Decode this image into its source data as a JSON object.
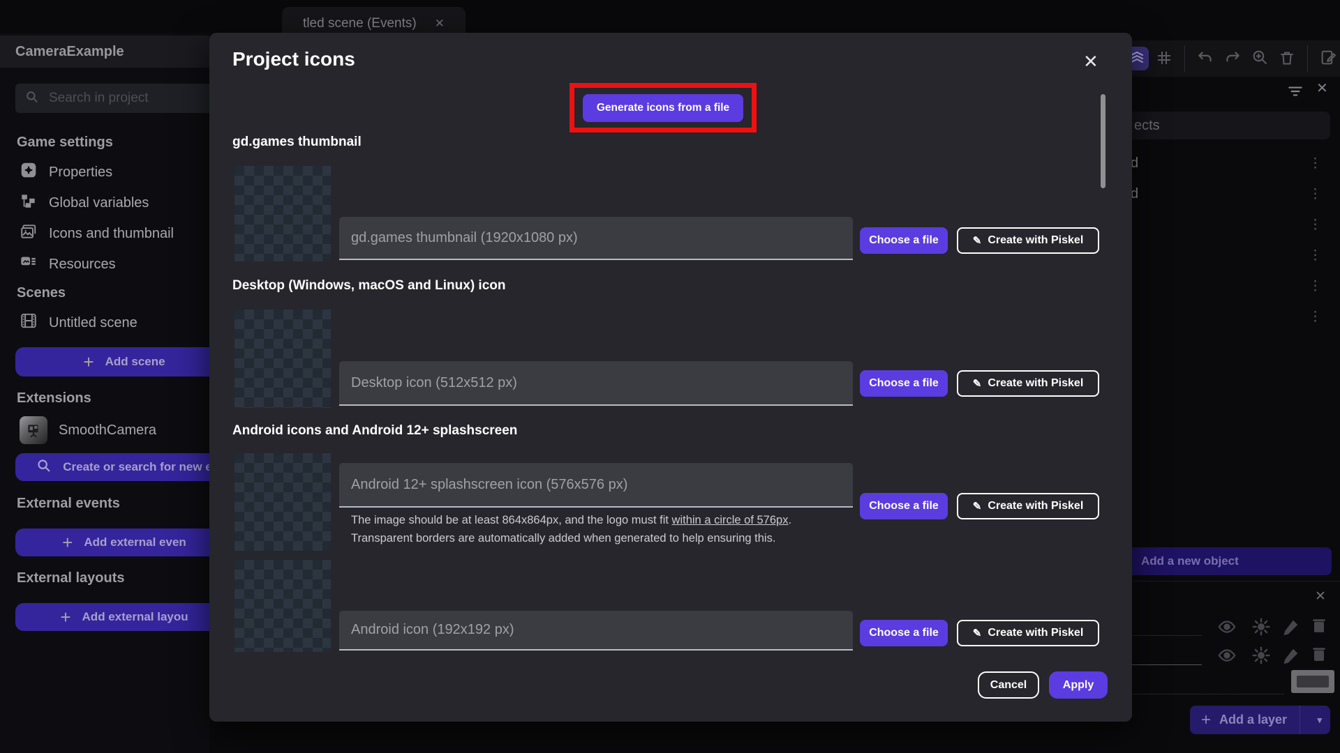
{
  "colors": {
    "accent": "#5b3ce0",
    "annotation_red": "#ed1111",
    "modal_bg": "#26262c"
  },
  "topbar": {
    "tab_title": "tled scene (Events)",
    "tab_close_icon": "✕"
  },
  "sidebar": {
    "project_name": "CameraExample",
    "search_placeholder": "Search in project",
    "game_settings_header": "Game settings",
    "game_settings_items": [
      {
        "label": "Properties"
      },
      {
        "label": "Global variables"
      },
      {
        "label": "Icons and thumbnail"
      },
      {
        "label": "Resources"
      }
    ],
    "scenes_header": "Scenes",
    "scene_name": "Untitled scene",
    "add_scene_label": "Add scene",
    "extensions_header": "Extensions",
    "extension_name": "SmoothCamera",
    "search_extensions_label": "Create or search for new e",
    "external_events_header": "External events",
    "add_external_events_label": "Add external even",
    "external_layouts_header": "External layouts",
    "add_external_layouts_label": "Add external layou",
    "plus_icon": "+"
  },
  "right_panel": {
    "search_text_fragment": "ects",
    "object_row_fragments": [
      "d",
      "d",
      "",
      "",
      "",
      ""
    ],
    "kebab_icon": "⋮",
    "close_icon": "✕",
    "add_object_label": "Add a new object",
    "layers_close_icon": "✕",
    "add_layer_label": "Add a layer",
    "caret_icon": "▾"
  },
  "modal": {
    "title": "Project icons",
    "close_icon": "✕",
    "generate_button_label": "Generate icons from a file",
    "choose_file_label": "Choose a file",
    "piskel_label": "Create with Piskel",
    "piskel_icon": "✎",
    "sections": [
      {
        "label": "gd.games thumbnail",
        "placeholder": "gd.games thumbnail (1920x1080 px)"
      },
      {
        "label": "Desktop (Windows, macOS and Linux) icon",
        "placeholder": "Desktop icon (512x512 px)"
      },
      {
        "label": "Android icons and Android 12+ splashscreen",
        "placeholder": "Android 12+ splashscreen icon (576x576 px)",
        "helper_prefix": "The image should be at least 864x864px, and the logo must fit ",
        "helper_underlined": "within a circle of 576px",
        "helper_suffix": ".",
        "helper_line2": "Transparent borders are automatically added when generated to help ensuring this."
      },
      {
        "label": "",
        "placeholder": "Android icon (192x192 px)"
      }
    ],
    "cancel_label": "Cancel",
    "apply_label": "Apply"
  }
}
